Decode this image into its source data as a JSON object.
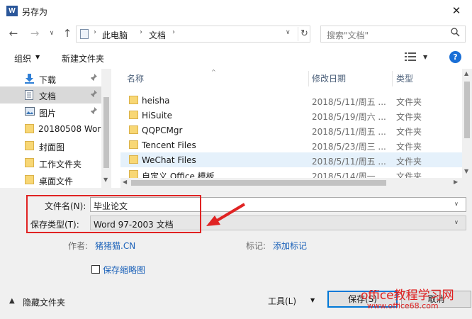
{
  "window": {
    "title": "另存为",
    "app_icon_letter": "W",
    "close_glyph": "✕",
    "accent_color": "#0078d7",
    "annotation_color": "#e02323"
  },
  "nav": {
    "back_glyph": "←",
    "forward_glyph": "→",
    "history_glyph": "∨",
    "up_glyph": "↑",
    "breadcrumb": [
      "此电脑",
      "文档"
    ],
    "breadcrumb_sep": "›",
    "address_dropdown": "∨",
    "refresh_glyph": "↻",
    "search_placeholder": "搜索\"文档\"",
    "search_glyph": "⚲"
  },
  "toolbar": {
    "organize": "组织",
    "organize_caret": "▼",
    "new_folder": "新建文件夹",
    "view_caret": "▼",
    "help": "?"
  },
  "sidebar": {
    "items": [
      {
        "label": "下载",
        "icon": "download-icon",
        "pinned": true
      },
      {
        "label": "文档",
        "icon": "document-icon",
        "pinned": true,
        "selected": true
      },
      {
        "label": "图片",
        "icon": "picture-icon",
        "pinned": true
      },
      {
        "label": "20180508 Wor",
        "icon": "folder-icon"
      },
      {
        "label": "封面图",
        "icon": "folder-icon"
      },
      {
        "label": "工作文件夹",
        "icon": "folder-icon"
      },
      {
        "label": "桌面文件",
        "icon": "folder-icon"
      }
    ],
    "pin_glyph": "📌",
    "scroll_down": "▼"
  },
  "files": {
    "columns": {
      "name": "名称",
      "date": "修改日期",
      "type": "类型"
    },
    "sort_glyph": "^",
    "rows": [
      {
        "name": "heisha",
        "date": "2018/5/11/周五 ...",
        "type": "文件夹"
      },
      {
        "name": "HiSuite",
        "date": "2018/5/19/周六 ...",
        "type": "文件夹"
      },
      {
        "name": "QQPCMgr",
        "date": "2018/5/11/周五 ...",
        "type": "文件夹"
      },
      {
        "name": "Tencent Files",
        "date": "2018/5/23/周三 ...",
        "type": "文件夹"
      },
      {
        "name": "WeChat Files",
        "date": "2018/5/11/周五 ...",
        "type": "文件夹",
        "highlighted": true
      },
      {
        "name": "自定义 Office 模板",
        "date": "2018/5/14/周一 ...",
        "type": "文件夹"
      }
    ],
    "scroll_up": "▲",
    "scroll_down": "▼",
    "scroll_left": "◀",
    "scroll_right": "▶"
  },
  "form": {
    "filename_label": "文件名(N):",
    "filename_value": "毕业论文",
    "filetype_label": "保存类型(T):",
    "filetype_value": "Word 97-2003 文档",
    "dropdown_glyph": "∨",
    "author_label": "作者:",
    "author_value": "猪猪猫.CN",
    "tags_label": "标记:",
    "tags_value": "添加标记",
    "thumbnail_label": "保存缩略图",
    "hide_folders": "隐藏文件夹",
    "hide_caret": "▲",
    "tools": "工具(L)",
    "tools_caret": "▼",
    "save": "保存(S)",
    "cancel": "取消"
  },
  "watermark": {
    "line1": "office教程学习网",
    "line2": "www.office68.com"
  }
}
